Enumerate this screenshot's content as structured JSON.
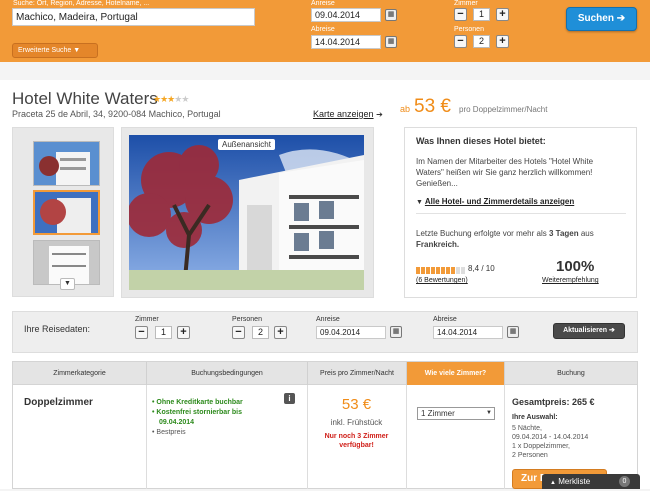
{
  "search": {
    "destination_label": "Suche: Ort, Region, Adresse, Hotelname, ...",
    "destination_value": "Machico, Madeira, Portugal",
    "anreise_label": "Anreise",
    "anreise_value": "09.04.2014",
    "abreise_label": "Abreise",
    "abreise_value": "14.04.2014",
    "zimmer_label": "Zimmer",
    "zimmer_value": "1",
    "personen_label": "Personen",
    "personen_value": "2",
    "search_button": "Suchen",
    "erweiterte_suche": "Erweiterte Suche"
  },
  "hotel": {
    "name": "Hotel White Waters",
    "stars": 3,
    "stars_max": 5,
    "address": "Praceta 25 de Abril, 34, 9200-084 Machico, Portugal",
    "map_link": "Karte anzeigen",
    "price_prefix": "ab",
    "price": "53 €",
    "price_suffix": "pro Doppelzimmer/Nacht",
    "image_badge": "Außenansicht"
  },
  "info": {
    "title": "Was Ihnen dieses Hotel bietet:",
    "text": "Im Namen der Mitarbeiter des Hotels \"Hotel White Waters\" heißen wir Sie ganz herzlich willkommen! Genießen...",
    "details_link": "Alle Hotel- und Zimmerdetails anzeigen",
    "last_booking_pre": "Letzte Buchung erfolgte vor mehr als",
    "last_booking_days": "3 Tagen",
    "last_booking_mid": "aus",
    "last_booking_country": "Frankreich.",
    "rating": "8,4 / 10",
    "rating_fraction": 0.84,
    "reviews_link": "(6 Bewertungen)",
    "recommend_pct": "100%",
    "recommend_link": "Weiterempfehlung"
  },
  "reisedaten": {
    "label": "Ihre Reisedaten:",
    "zimmer_label": "Zimmer",
    "zimmer_value": "1",
    "personen_label": "Personen",
    "personen_value": "2",
    "anreise_label": "Anreise",
    "anreise_value": "09.04.2014",
    "abreise_label": "Abreise",
    "abreise_value": "14.04.2014",
    "update_button": "Aktualisieren"
  },
  "table": {
    "headers": [
      "Zimmerkategorie",
      "Buchungsbedingungen",
      "Preis pro Zimmer/Nacht",
      "Wie viele Zimmer?",
      "Buchung"
    ],
    "room": "Doppelzimmer",
    "conditions": [
      "Ohne Kreditkarte buchbar",
      "Kostenfrei stornierbar bis 09.04.2014",
      "Bestpreis"
    ],
    "price": "53 €",
    "price_note": "inkl. Frühstück",
    "availability": "Nur noch 3 Zimmer verfügbar!",
    "room_select": "1 Zimmer",
    "total_label": "Gesamtpreis: 265 €",
    "selection_title": "Ihre Auswahl:",
    "selection_nights": "5 Nächte,",
    "selection_dates": "09.04.2014 - 14.04.2014",
    "selection_room": "1 x Doppelzimmer,",
    "selection_persons": "2 Personen",
    "book_button": "Zur B",
    "merkliste": "Merkliste",
    "merkliste_count": "0"
  },
  "colors": {
    "orange": "#f29a38",
    "blue": "#1f8fd8",
    "green": "#2d8a1c",
    "red": "#d0201a"
  }
}
